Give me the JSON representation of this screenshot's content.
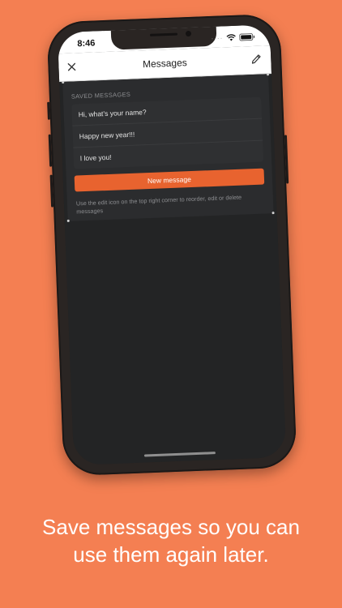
{
  "status_bar": {
    "time": "8:46"
  },
  "navbar": {
    "title": "Messages"
  },
  "saved": {
    "header": "SAVED MESSAGES",
    "messages": [
      "Hi, what’s your name?",
      "Happy new year!!!",
      "I love you!"
    ],
    "new_button": "New message",
    "hint": "Use the edit icon on the top right corner to reorder, edit or delete messages"
  },
  "caption": {
    "line1": "Save messages so you can",
    "line2": "use them again later."
  },
  "colors": {
    "background": "#F47F52",
    "accent": "#E8632F",
    "screen": "#232425"
  }
}
